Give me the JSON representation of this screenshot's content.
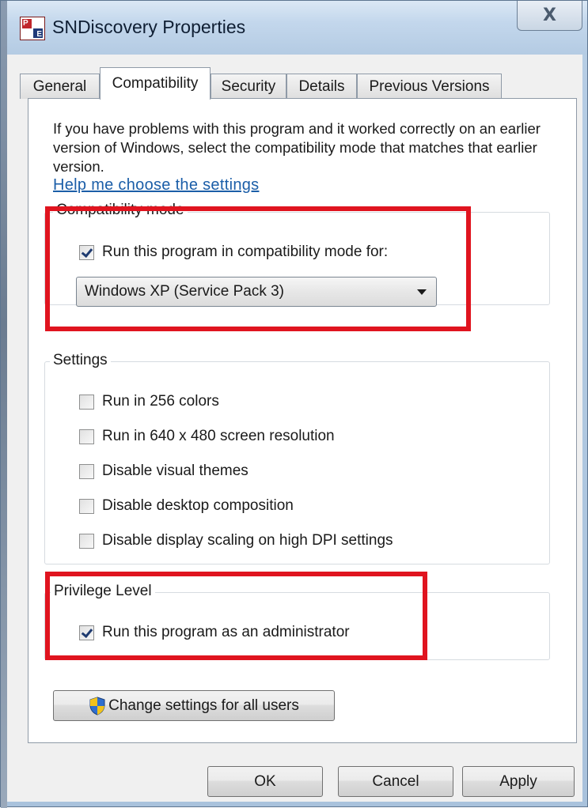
{
  "window": {
    "title": "SNDiscovery Properties",
    "close_glyph": "X",
    "icon": "app-icon",
    "icon_text_top": "P",
    "icon_text_bottom": "E"
  },
  "tabs": [
    {
      "label": "General",
      "active": false
    },
    {
      "label": "Compatibility",
      "active": true
    },
    {
      "label": "Security",
      "active": false
    },
    {
      "label": "Details",
      "active": false
    },
    {
      "label": "Previous Versions",
      "active": false
    }
  ],
  "intro": {
    "text": "If you have problems with this program and it worked correctly on an earlier version of Windows, select the compatibility mode that matches that earlier version.",
    "help_link": "Help me choose the settings"
  },
  "compatibility_mode": {
    "label": "Compatibility mode",
    "checkbox_label": "Run this program in compatibility mode for:",
    "checked": true,
    "selected_os": "Windows XP (Service Pack 3)"
  },
  "settings": {
    "label": "Settings",
    "options": [
      {
        "label": "Run in 256 colors",
        "checked": false
      },
      {
        "label": "Run in 640 x 480 screen resolution",
        "checked": false
      },
      {
        "label": "Disable visual themes",
        "checked": false
      },
      {
        "label": "Disable desktop composition",
        "checked": false
      },
      {
        "label": "Disable display scaling on high DPI settings",
        "checked": false
      }
    ]
  },
  "privilege": {
    "label": "Privilege Level",
    "checkbox_label": "Run this program as an administrator",
    "checked": true
  },
  "change_all_users": {
    "label": "Change settings for all users",
    "icon": "uac-shield-icon"
  },
  "buttons": {
    "ok": "OK",
    "cancel": "Cancel",
    "apply": "Apply"
  },
  "colors": {
    "highlight": "#e0141f",
    "link": "#1b5ea8"
  }
}
